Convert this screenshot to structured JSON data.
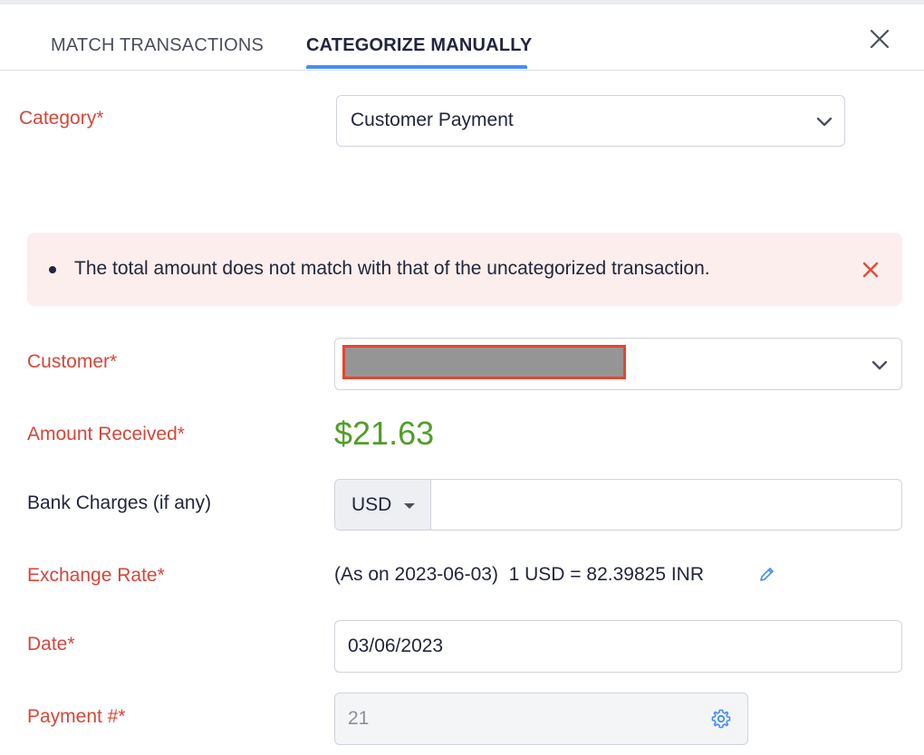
{
  "tabs": {
    "match_label": "MATCH TRANSACTIONS",
    "categorize_label": "CATEGORIZE MANUALLY",
    "active": "categorize"
  },
  "icons": {
    "close": "close-icon",
    "chevron": "chevron-down-icon",
    "alert_close": "close-icon",
    "edit": "pencil-icon",
    "settings": "gear-icon"
  },
  "colors": {
    "accent": "#408dfb",
    "required_label": "#d6463a",
    "amount": "#529d29",
    "alert_bg": "#fbeeec",
    "alert_close": "#e04f3f"
  },
  "form": {
    "category": {
      "label": "Category*",
      "value": "Customer Payment"
    },
    "alert": {
      "message": "The total amount does not match with that of the uncategorized transaction."
    },
    "customer": {
      "label": "Customer*",
      "value_redacted": true
    },
    "amount_received": {
      "label": "Amount Received*",
      "value": "$21.63"
    },
    "bank_charges": {
      "label": "Bank Charges (if any)",
      "currency": "USD",
      "value": ""
    },
    "exchange_rate": {
      "label": "Exchange Rate*",
      "as_on": "(As on 2023-06-03)",
      "rate": "1 USD = 82.39825 INR"
    },
    "date": {
      "label": "Date*",
      "value": "03/06/2023"
    },
    "payment_number": {
      "label": "Payment #*",
      "value": "21"
    }
  }
}
